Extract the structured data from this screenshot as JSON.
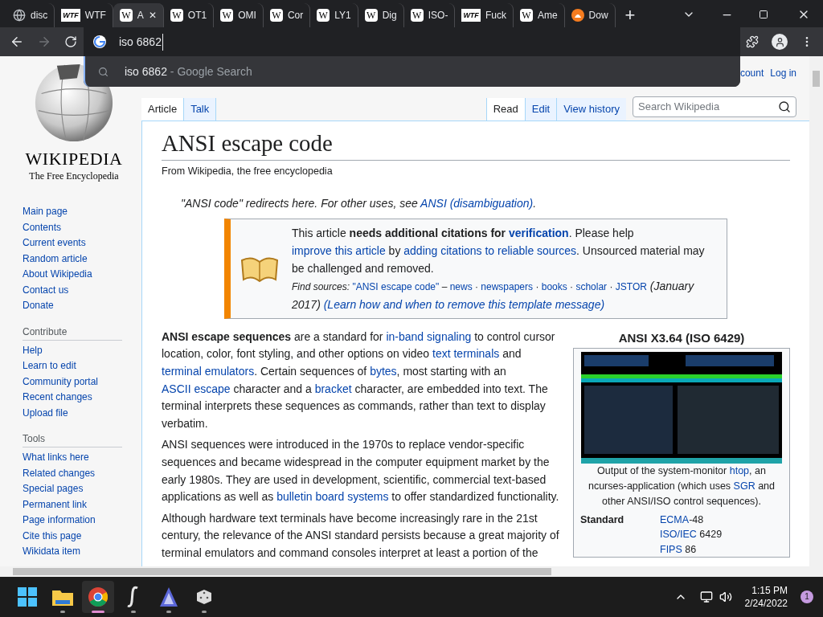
{
  "browser": {
    "tabs": [
      {
        "kind": "globe",
        "title": "disc",
        "selected": false
      },
      {
        "kind": "wtf",
        "favicon_text": "WTF",
        "title": "WTF",
        "selected": false
      },
      {
        "kind": "wiki",
        "favicon_text": "W",
        "title": "A",
        "selected": true,
        "close": "✕"
      },
      {
        "kind": "wiki",
        "favicon_text": "W",
        "title": "OT1",
        "selected": false
      },
      {
        "kind": "wiki",
        "favicon_text": "W",
        "title": "OMI",
        "selected": false
      },
      {
        "kind": "wiki",
        "favicon_text": "W",
        "title": "Cor",
        "selected": false
      },
      {
        "kind": "wiki",
        "favicon_text": "W",
        "title": "LY1",
        "selected": false
      },
      {
        "kind": "wiki",
        "favicon_text": "W",
        "title": "Dig",
        "selected": false
      },
      {
        "kind": "wiki",
        "favicon_text": "W",
        "title": "ISO-",
        "selected": false
      },
      {
        "kind": "wtf",
        "favicon_text": "WTF",
        "title": "Fuck",
        "selected": false
      },
      {
        "kind": "wiki",
        "favicon_text": "W",
        "title": "Ame",
        "selected": false
      },
      {
        "kind": "fox",
        "title": "Dow",
        "selected": false
      }
    ],
    "new_tab": "+",
    "forward_disabled": true,
    "address": "iso 6862",
    "suggestions": [
      {
        "query": "iso 6862",
        "source": " - Google Search",
        "selected": true
      }
    ]
  },
  "wiki": {
    "logo": {
      "wordmark": "WIKIPEDIA",
      "tagline": "The Free Encyclopedia"
    },
    "personal": [
      "count",
      "Log in"
    ],
    "nav": [
      {
        "items": [
          "Main page",
          "Contents",
          "Current events",
          "Random article",
          "About Wikipedia",
          "Contact us",
          "Donate"
        ]
      },
      {
        "heading": "Contribute",
        "items": [
          "Help",
          "Learn to edit",
          "Community portal",
          "Recent changes",
          "Upload file"
        ]
      },
      {
        "heading": "Tools",
        "items": [
          "What links here",
          "Related changes",
          "Special pages",
          "Permanent link",
          "Page information",
          "Cite this page",
          "Wikidata item"
        ]
      }
    ],
    "left_tabs": [
      {
        "label": "Article",
        "selected": true
      },
      {
        "label": "Talk",
        "selected": false
      }
    ],
    "right_tabs": [
      {
        "label": "Read",
        "selected": true
      },
      {
        "label": "Edit",
        "selected": false
      },
      {
        "label": "View history",
        "selected": false
      }
    ],
    "search": {
      "placeholder": "Search Wikipedia"
    },
    "title": "ANSI escape code",
    "tagline": "From Wikipedia, the free encyclopedia",
    "hatnote": [
      {
        "t": "\"ANSI code\" redirects here. For other uses, see "
      },
      {
        "t": "ANSI (disambiguation)",
        "link": true
      },
      {
        "t": "."
      }
    ],
    "notice": {
      "text": [
        {
          "t": "This article **needs additional citations for** "
        },
        {
          "t": "**verification**",
          "link": true
        },
        {
          "t": ". Please help "
        },
        {
          "t": "improve this article",
          "link": true
        },
        {
          "t": " by "
        },
        {
          "t": "adding citations to reliable sources",
          "link": true
        },
        {
          "t": ". Unsourced material may be challenged and removed."
        }
      ],
      "sources": [
        {
          "t": "*Find sources:* ",
          "small": true
        },
        {
          "t": "\"ANSI escape code\"",
          "link": true,
          "small": true
        },
        {
          "t": " – ",
          "small": true
        },
        {
          "t": "news",
          "link": true,
          "small": true
        },
        {
          "t": " · ",
          "small": true
        },
        {
          "t": "newspapers",
          "link": true,
          "small": true
        },
        {
          "t": " · ",
          "small": true
        },
        {
          "t": "books",
          "link": true,
          "small": true
        },
        {
          "t": " · ",
          "small": true
        },
        {
          "t": "scholar",
          "link": true,
          "small": true
        },
        {
          "t": " · ",
          "small": true
        },
        {
          "t": "JSTOR",
          "link": true,
          "small": true
        },
        {
          "t": " *(January 2017)* "
        },
        {
          "t": "*(Learn how and when to remove this template message)*",
          "link": true
        }
      ]
    },
    "paragraphs": [
      [
        {
          "t": "**ANSI escape sequences** are a standard for "
        },
        {
          "t": "in-band signaling",
          "link": true
        },
        {
          "t": " to control cursor location, color, font styling, and other options on video "
        },
        {
          "t": "text terminals",
          "link": true
        },
        {
          "t": " and "
        },
        {
          "t": "terminal emulators",
          "link": true
        },
        {
          "t": ". Certain sequences of "
        },
        {
          "t": "bytes",
          "link": true
        },
        {
          "t": ", most starting with an "
        },
        {
          "t": "ASCII escape",
          "link": true
        },
        {
          "t": " character and a "
        },
        {
          "t": "bracket",
          "link": true
        },
        {
          "t": " character, are embedded into text. The terminal interprets these sequences as commands, rather than text to display verbatim."
        }
      ],
      [
        {
          "t": "ANSI sequences were introduced in the 1970s to replace vendor-specific sequences and became widespread in the computer equipment market by the early 1980s. They are used in development, scientific, commercial text-based applications as well as "
        },
        {
          "t": "bulletin board systems",
          "link": true
        },
        {
          "t": " to offer standardized functionality."
        }
      ],
      [
        {
          "t": "Although hardware text terminals have become increasingly rare in the 21st century, the relevance of the ANSI standard persists because a great majority of terminal emulators and command consoles interpret at least a portion of the"
        }
      ]
    ],
    "infobox": {
      "title": "ANSI X3.64 (ISO 6429)",
      "caption": [
        {
          "t": "Output of the system-monitor "
        },
        {
          "t": "htop",
          "link": true
        },
        {
          "t": ", an ncurses-application (which uses "
        },
        {
          "t": "SGR",
          "link": true
        },
        {
          "t": " and other ANSI/ISO control sequences)."
        }
      ],
      "rows": [
        {
          "label": "Standard",
          "values": [
            [
              {
                "t": "ECMA",
                "link": true
              },
              {
                "t": "-48"
              }
            ],
            [
              {
                "t": "ISO/IEC",
                "link": true
              },
              {
                "t": " 6429"
              }
            ],
            [
              {
                "t": "FIPS",
                "link": true
              },
              {
                "t": " 86"
              }
            ]
          ]
        }
      ]
    }
  },
  "taskbar": {
    "apps": [
      {
        "kind": "start",
        "active": false,
        "running": false
      },
      {
        "kind": "folder",
        "active": false,
        "running": true
      },
      {
        "kind": "chrome",
        "active": true,
        "running": true
      },
      {
        "kind": "script",
        "active": false,
        "running": true
      },
      {
        "kind": "letter-a",
        "active": false,
        "running": true
      },
      {
        "kind": "dice",
        "active": false,
        "running": true
      }
    ],
    "time": "1:15 PM",
    "date": "2/24/2022",
    "notifications": "1"
  }
}
